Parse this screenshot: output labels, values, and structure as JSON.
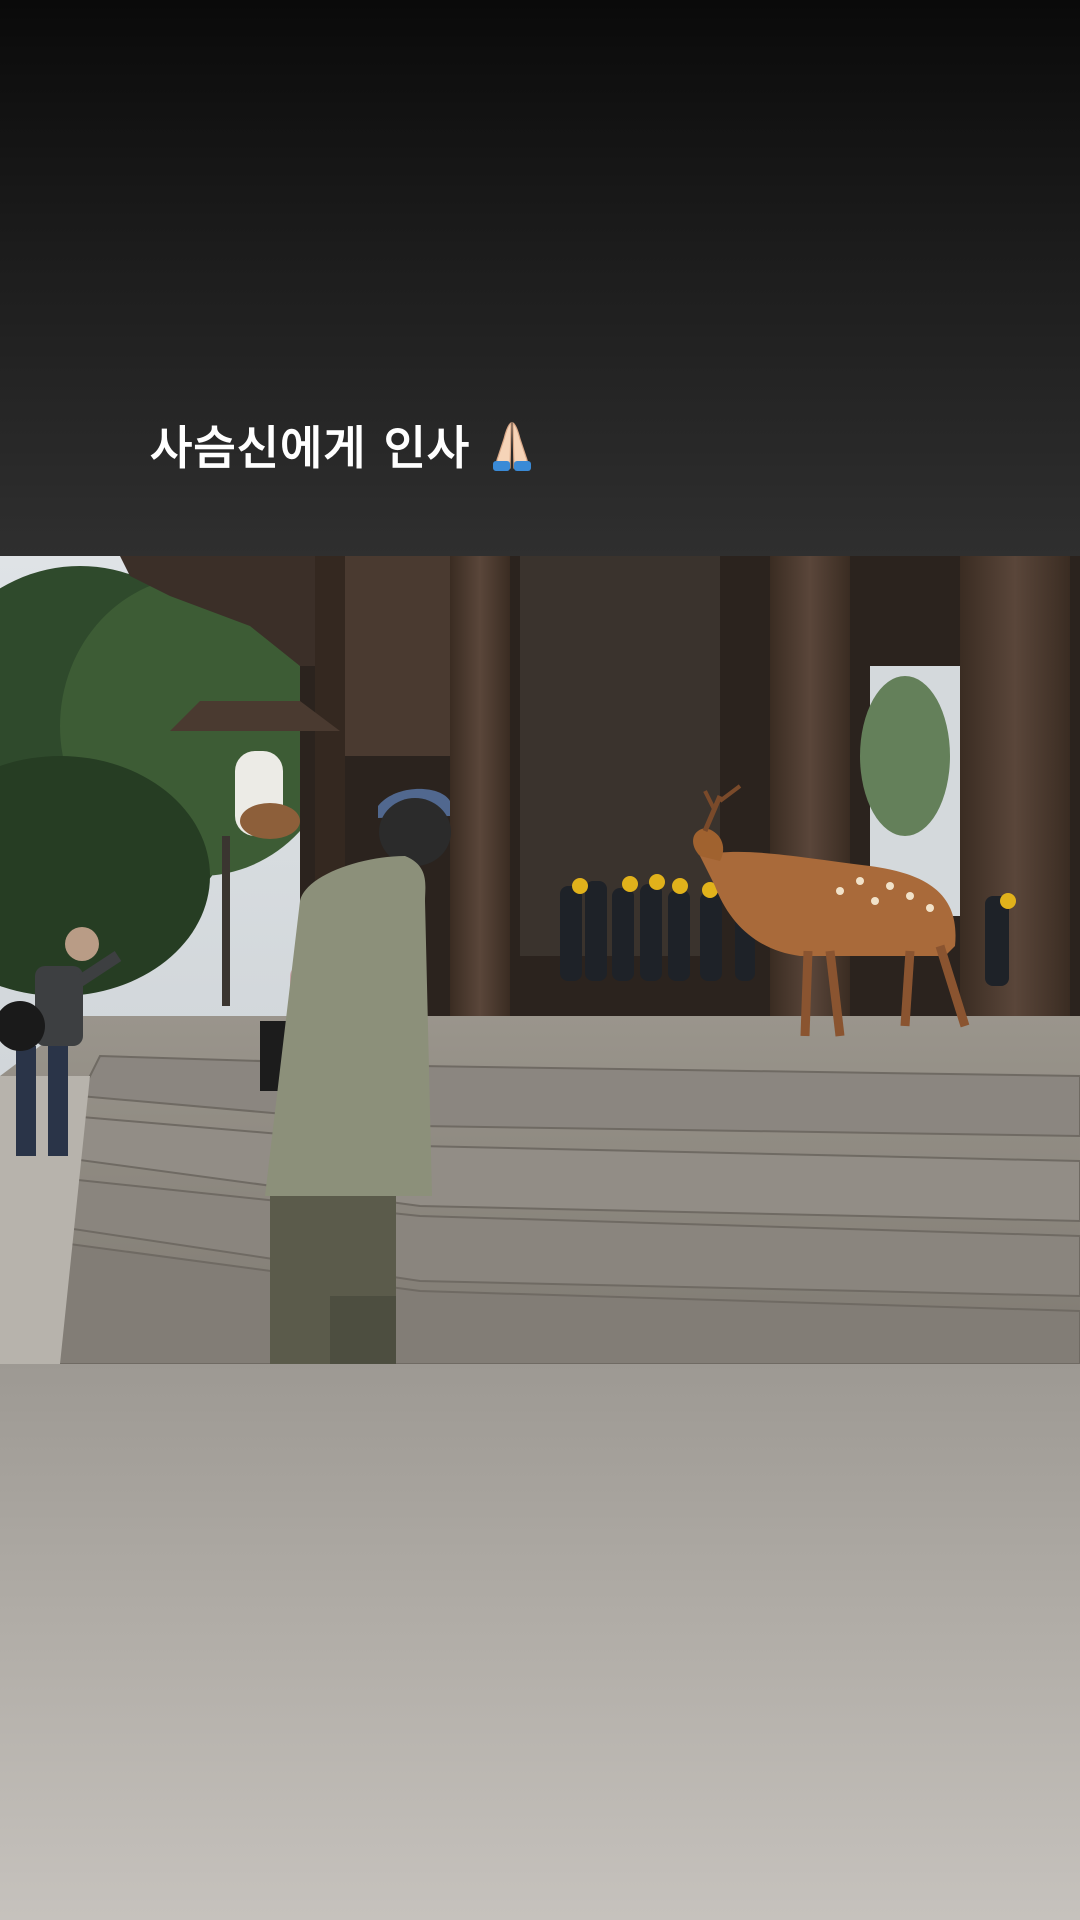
{
  "story": {
    "caption": {
      "text": "사슴신에게 인사",
      "emoji": "folded-hands-icon"
    },
    "background": {
      "top_color": "#0a0a0a",
      "top_mid_color": "#2f2f2f",
      "bottom_color": "#c6c2bd"
    },
    "photo": {
      "subject": "photo"
    }
  }
}
